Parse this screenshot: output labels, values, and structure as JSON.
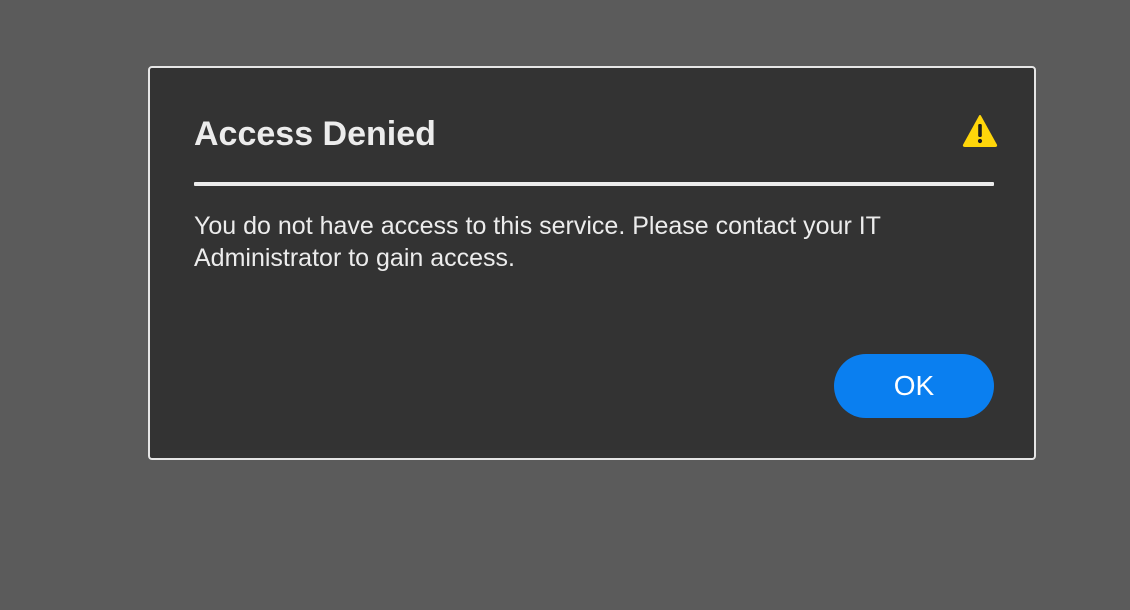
{
  "dialog": {
    "title": "Access Denied",
    "icon": "warning-icon",
    "message": "You do not have access to this service. Please contact your IT Administrator to gain access.",
    "ok_label": "OK"
  },
  "colors": {
    "backdrop": "#5b5b5b",
    "dialog_background": "#333333",
    "dialog_border": "#e6e6e6",
    "text": "#ececec",
    "accent": "#0a7ff0",
    "warning": "#ffd60a"
  }
}
